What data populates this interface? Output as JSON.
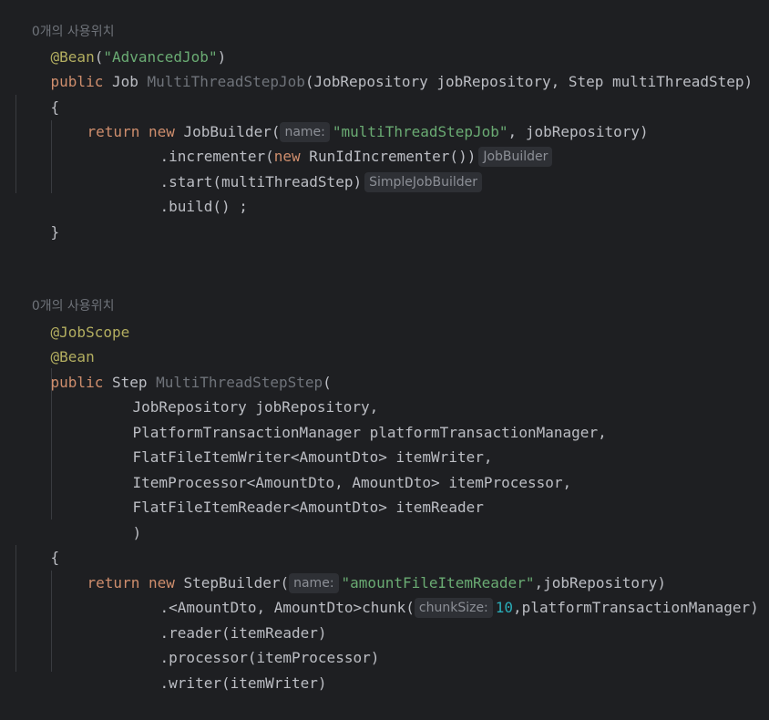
{
  "editor": {
    "block1": {
      "usages": "0개의 사용위치",
      "annotation": "@Bean",
      "annotation_arg_open": "(",
      "annotation_arg": "\"AdvancedJob\"",
      "annotation_arg_close": ")",
      "sig_public": "public",
      "sig_type": " Job ",
      "sig_name": "MultiThreadStepJob",
      "sig_params": "(JobRepository jobRepository, Step multiThreadStep)",
      "open_brace": "{",
      "ret_return": "return",
      "ret_new": "new",
      "ret_call": " JobBuilder(",
      "ret_hint": "name:",
      "ret_str": "\"multiThreadStepJob\"",
      "ret_tail": ", jobRepository)",
      "inc_head": ".incrementer(",
      "inc_new": "new",
      "inc_tail": " RunIdIncrementer())",
      "inc_type_hint": "JobBuilder",
      "start_code": ".start(multiThreadStep)",
      "start_type_hint": "SimpleJobBuilder",
      "build_code": ".build() ;",
      "close_brace": "}"
    },
    "block2": {
      "usages": "0개의 사용위치",
      "annotation1": "@JobScope",
      "annotation2": "@Bean",
      "sig_public": "public",
      "sig_type": " Step ",
      "sig_name": "MultiThreadStepStep",
      "sig_open": "(",
      "param1": "JobRepository jobRepository,",
      "param2": "PlatformTransactionManager platformTransactionManager,",
      "param3": "FlatFileItemWriter<AmountDto> itemWriter,",
      "param4": "ItemProcessor<AmountDto, AmountDto> itemProcessor,",
      "param5": "FlatFileItemReader<AmountDto> itemReader",
      "param_close": ")",
      "open_brace": "{",
      "ret_return": "return",
      "ret_new": "new",
      "ret_call": " StepBuilder(",
      "ret_hint": "name:",
      "ret_str": "\"amountFileItemReader\"",
      "ret_tail": ",jobRepository)",
      "chunk_head": ".<AmountDto, AmountDto>chunk(",
      "chunk_hint": "chunkSize:",
      "chunk_num": "10",
      "chunk_tail": ",platformTransactionManager)",
      "reader_code": ".reader(itemReader)",
      "processor_code": ".processor(itemProcessor)",
      "writer_code": ".writer(itemWriter)"
    }
  }
}
